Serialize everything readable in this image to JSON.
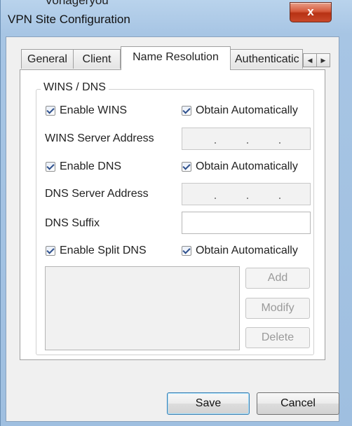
{
  "top_fragment": "Vonageryou",
  "window": {
    "title": "VPN Site Configuration",
    "close_glyph": "x"
  },
  "tabs": [
    {
      "label": "General"
    },
    {
      "label": "Client"
    },
    {
      "label": "Name Resolution",
      "active": true
    },
    {
      "label": "Authenticatic"
    }
  ],
  "tab_scroll": {
    "left_icon": "scroll-left-icon",
    "right_icon": "scroll-right-icon",
    "left_glyph": "◀",
    "right_glyph": "▶"
  },
  "group": {
    "title": "WINS / DNS",
    "enable_wins": {
      "label": "Enable WINS",
      "checked": true
    },
    "wins_obtain_auto": {
      "label": "Obtain Automatically",
      "checked": true
    },
    "wins_server_label": "WINS Server Address",
    "enable_dns": {
      "label": "Enable DNS",
      "checked": true
    },
    "dns_obtain_auto": {
      "label": "Obtain Automatically",
      "checked": true
    },
    "dns_server_label": "DNS Server Address",
    "dns_suffix_label": "DNS Suffix",
    "enable_split_dns": {
      "label": "Enable Split DNS",
      "checked": true
    },
    "split_obtain_auto": {
      "label": "Obtain Automatically",
      "checked": true
    }
  },
  "list_buttons": {
    "add": "Add",
    "modify": "Modify",
    "delete": "Delete"
  },
  "footer": {
    "save": "Save",
    "cancel": "Cancel"
  },
  "colors": {
    "frame": "#a7c5e4",
    "close": "#c9482a",
    "client_bg": "#f0f0f0"
  }
}
